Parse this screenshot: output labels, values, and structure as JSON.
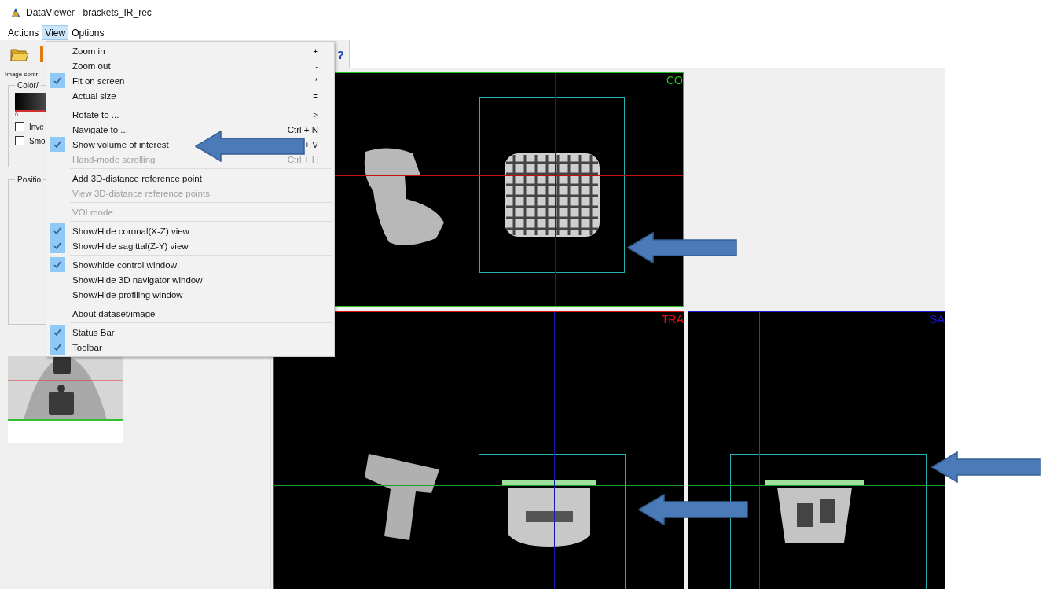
{
  "window": {
    "title": "DataViewer - brackets_IR_rec"
  },
  "menubar": [
    {
      "label": "Actions",
      "selected": false
    },
    {
      "label": "View",
      "selected": true
    },
    {
      "label": "Options",
      "selected": false
    }
  ],
  "toolbar": {
    "help_glyph": "?"
  },
  "control_panel": {
    "tab": "Image contr",
    "color_group": "Color/",
    "colorbar_min": "0",
    "checkboxes": [
      {
        "label": "Inve",
        "checked": false
      },
      {
        "label": "Smo",
        "checked": false
      }
    ],
    "position_group": "Positio"
  },
  "views": [
    {
      "label": "CO",
      "color": "#22c322"
    },
    {
      "label": "TRA",
      "color": "#e01010"
    },
    {
      "label": "SA",
      "color": "#1a1ad0"
    }
  ],
  "menu": {
    "items": [
      {
        "kind": "item",
        "label": "Zoom in",
        "shortcut": "+",
        "checked": false,
        "disabled": false
      },
      {
        "kind": "item",
        "label": "Zoom out",
        "shortcut": "-",
        "checked": false,
        "disabled": false
      },
      {
        "kind": "item",
        "label": "Fit on screen",
        "shortcut": "*",
        "checked": true,
        "disabled": false
      },
      {
        "kind": "item",
        "label": "Actual size",
        "shortcut": "=",
        "checked": false,
        "disabled": false
      },
      {
        "kind": "separator"
      },
      {
        "kind": "item",
        "label": "Rotate to ...",
        "shortcut": ">",
        "checked": false,
        "disabled": false
      },
      {
        "kind": "item",
        "label": "Navigate to ...",
        "shortcut": "Ctrl + N",
        "checked": false,
        "disabled": false
      },
      {
        "kind": "item",
        "label": "Show volume of interest",
        "shortcut": "+ V",
        "checked": true,
        "disabled": false
      },
      {
        "kind": "item",
        "label": "Hand-mode  scrolling",
        "shortcut": "Ctrl + H",
        "checked": false,
        "disabled": true
      },
      {
        "kind": "separator"
      },
      {
        "kind": "item",
        "label": "Add 3D-distance reference point",
        "checked": false,
        "disabled": false
      },
      {
        "kind": "item",
        "label": "View 3D-distance reference points",
        "checked": false,
        "disabled": true
      },
      {
        "kind": "separator"
      },
      {
        "kind": "item",
        "label": "VOI mode",
        "checked": false,
        "disabled": true
      },
      {
        "kind": "separator"
      },
      {
        "kind": "item",
        "label": "Show/Hide coronal(X-Z) view",
        "checked": true,
        "disabled": false
      },
      {
        "kind": "item",
        "label": "Show/Hide sagittal(Z-Y) view",
        "checked": true,
        "disabled": false
      },
      {
        "kind": "separator"
      },
      {
        "kind": "item",
        "label": "Show/hide control window",
        "checked": true,
        "disabled": false
      },
      {
        "kind": "item",
        "label": "Show/Hide 3D navigator window",
        "checked": false,
        "disabled": false
      },
      {
        "kind": "item",
        "label": "Show/Hide profiling window",
        "checked": false,
        "disabled": false
      },
      {
        "kind": "separator"
      },
      {
        "kind": "item",
        "label": "About dataset/image",
        "checked": false,
        "disabled": false
      },
      {
        "kind": "separator"
      },
      {
        "kind": "item",
        "label": "Status Bar",
        "checked": true,
        "disabled": false
      },
      {
        "kind": "item",
        "label": "Toolbar",
        "checked": true,
        "disabled": false
      }
    ]
  }
}
